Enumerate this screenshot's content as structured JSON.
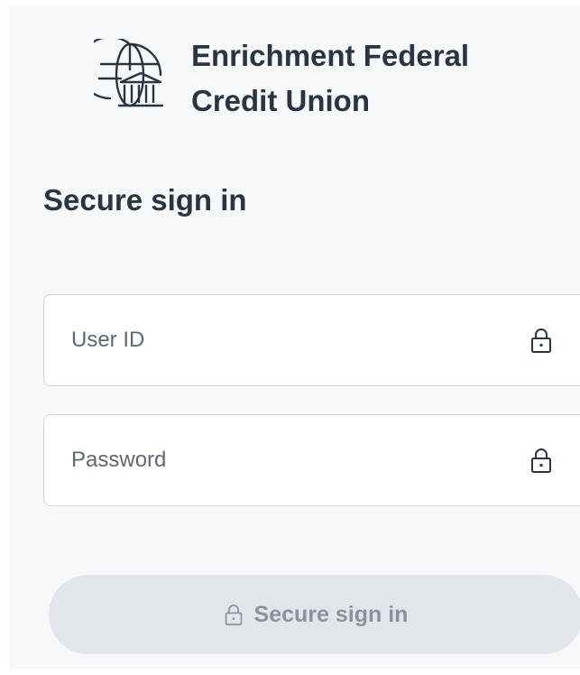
{
  "brand": {
    "name_line1": "Enrichment Federal",
    "name_line2": "Credit Union",
    "logo_icon": "globe-bank-icon"
  },
  "page": {
    "title": "Secure sign in"
  },
  "form": {
    "user_id": {
      "placeholder": "User ID",
      "value": "",
      "icon": "lock-icon"
    },
    "password": {
      "placeholder": "Password",
      "value": "",
      "icon": "lock-icon"
    },
    "submit": {
      "label": "Secure sign in",
      "icon": "lock-icon",
      "disabled": true
    }
  },
  "colors": {
    "text": "#2b3443",
    "panel_background": "#f7f8f9",
    "field_border": "#cfd4da",
    "button_disabled_background": "#e2e5e9",
    "button_disabled_text": "#8b929c"
  }
}
